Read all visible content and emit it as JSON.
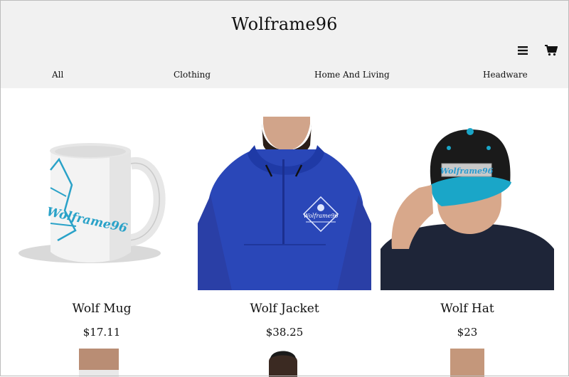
{
  "header": {
    "brand": "Wolframe96"
  },
  "nav": {
    "items": [
      "All",
      "Clothing",
      "Home And Living",
      "Headware"
    ]
  },
  "products": [
    {
      "name": "Wolf Mug",
      "price": "$17.11",
      "logo_text": "Wolframe96"
    },
    {
      "name": "Wolf Jacket",
      "price": "$38.25",
      "logo_text": "Wolframe96"
    },
    {
      "name": "Wolf Hat",
      "price": "$23",
      "logo_text": "Wolframe96"
    }
  ],
  "icons": [
    "menu-icon",
    "cart-icon"
  ],
  "colors": {
    "header_bg": "#f1f1f1",
    "jacket_blue": "#2a47b8",
    "hat_teal": "#1aa6c8",
    "logo_blue": "#2a9bd0"
  }
}
